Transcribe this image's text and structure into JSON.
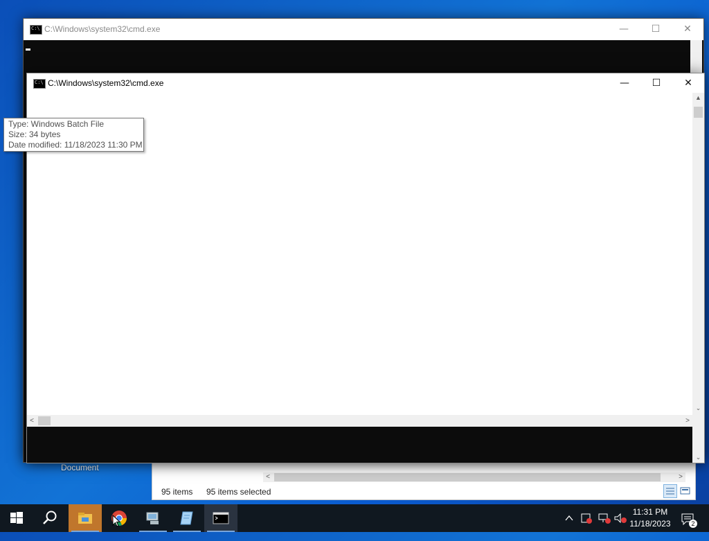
{
  "desktop": {
    "partial_label": "Document"
  },
  "explorer": {
    "item_count": "95 items",
    "selected_count": "95 items selected",
    "scroll_left": "<",
    "scroll_right": ">"
  },
  "cmd_back": {
    "title": "C:\\Windows\\system32\\cmd.exe",
    "minimize": "—",
    "maximize": "☐",
    "close": "✕"
  },
  "cmd_front": {
    "title": "C:\\Windows\\system32\\cmd.exe",
    "minimize": "—",
    "maximize": "☐",
    "close": "✕",
    "scroll_up": "▲",
    "scroll_down": "⌄",
    "scroll_left": "<",
    "scroll_right": ">"
  },
  "tooltip": {
    "type": "Type: Windows Batch File",
    "size": "Size: 34 bytes",
    "modified": "Date modified: 11/18/2023 11:30 PM"
  },
  "taskbar": {
    "items": [
      {
        "icon": "windows-start-icon"
      },
      {
        "icon": "search-icon"
      },
      {
        "icon": "file-explorer-icon",
        "active": true
      },
      {
        "icon": "chrome-icon"
      },
      {
        "icon": "network-computer-icon"
      },
      {
        "icon": "notepad-icon"
      },
      {
        "icon": "cmd-icon"
      }
    ],
    "clock_time": "11:31 PM",
    "clock_date": "11/18/2023",
    "notification_count": "2"
  },
  "colors": {
    "desktop_blue": "#0f6ad3",
    "taskbar": "#101820",
    "active_task": "#c0762c",
    "console_bg": "#0c0c0c"
  }
}
